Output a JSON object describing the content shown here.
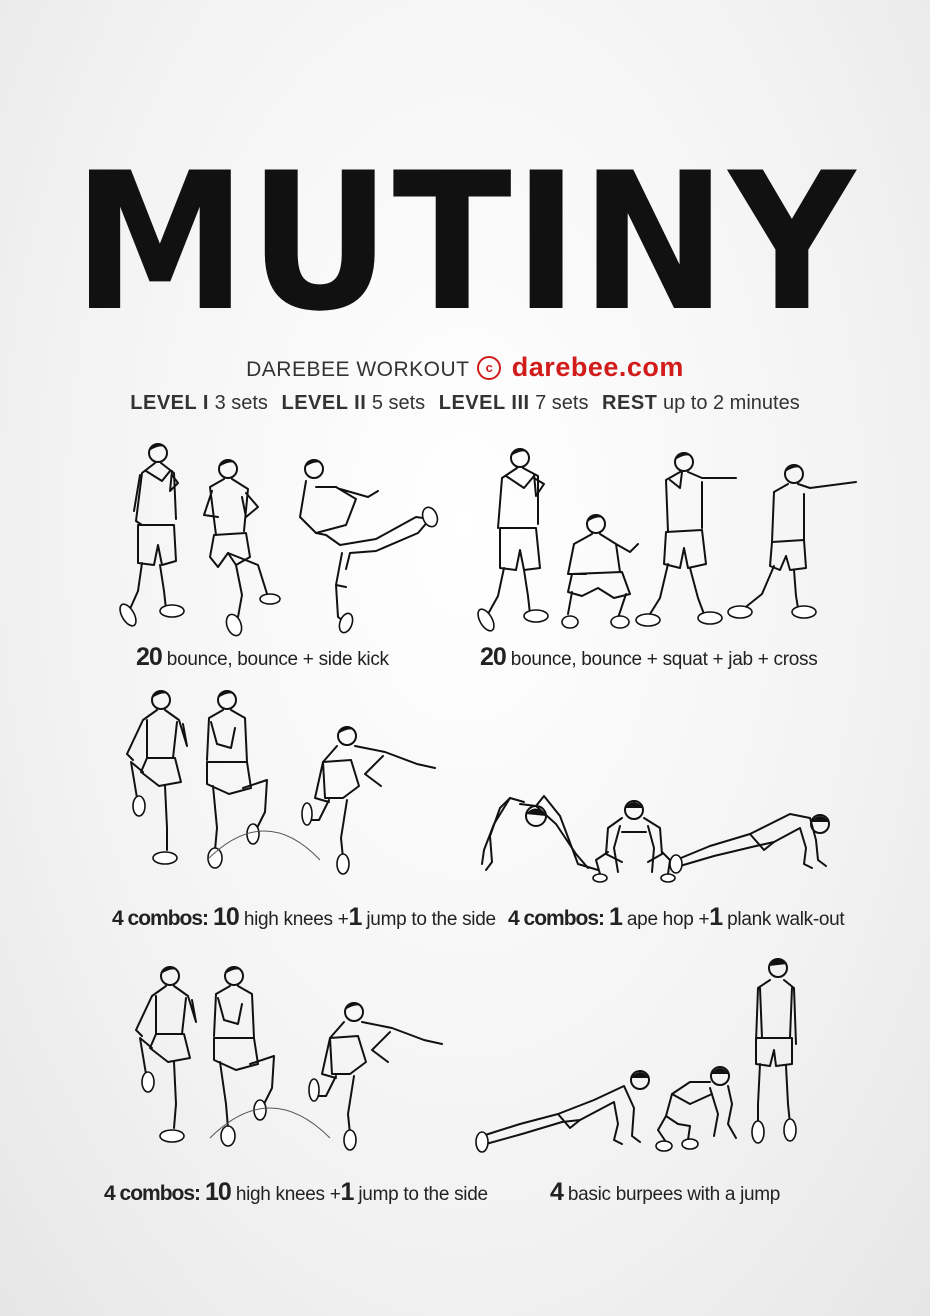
{
  "title": "MUTINY",
  "header": {
    "brand_text": "DAREBEE WORKOUT",
    "copyright_symbol": "c",
    "site": "darebee.com",
    "accent_color": "#d21c1c"
  },
  "levels": {
    "level1_label": "LEVEL I",
    "level1_value": "3 sets",
    "level2_label": "LEVEL II",
    "level2_value": "5 sets",
    "level3_label": "LEVEL III",
    "level3_value": "7 sets",
    "rest_label": "REST",
    "rest_value": "up to 2 minutes"
  },
  "exercises": [
    {
      "prefix": "",
      "parts": [
        {
          "num": "20",
          "text": "bounce, bounce + side kick"
        }
      ]
    },
    {
      "prefix": "",
      "parts": [
        {
          "num": "20",
          "text": "bounce, bounce + squat + jab + cross"
        }
      ]
    },
    {
      "prefix": "4 combos:",
      "parts": [
        {
          "num": "10",
          "text": "high knees +"
        },
        {
          "num": "1",
          "text": "jump to the side"
        }
      ]
    },
    {
      "prefix": "4 combos:",
      "parts": [
        {
          "num": "1",
          "text": "ape hop +"
        },
        {
          "num": "1",
          "text": "plank walk-out"
        }
      ]
    },
    {
      "prefix": "4 combos:",
      "parts": [
        {
          "num": "10",
          "text": "high knees +"
        },
        {
          "num": "1",
          "text": "jump to the side"
        }
      ]
    },
    {
      "prefix": "",
      "parts": [
        {
          "num": "4",
          "text": "basic burpees with a jump"
        }
      ]
    }
  ]
}
